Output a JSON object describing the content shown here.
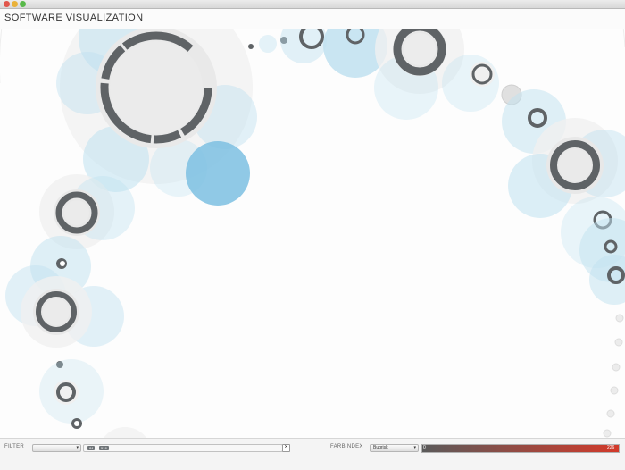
{
  "window": {
    "title": "SOFTWARE VISUALIZATION",
    "traffic_lights": [
      "#e1574c",
      "#e9b23a",
      "#58b94a"
    ]
  },
  "footer": {
    "filter_label": "FILTER",
    "filter_select_value": "",
    "search_tags": [
      "84",
      "518"
    ],
    "clear_symbol": "×",
    "color_index_label": "FARBINDEX",
    "color_index_value": "Bugrisk",
    "scale_min": "0",
    "scale_max": "226"
  },
  "visualization": {
    "colors": {
      "halo": "#bfe1f0",
      "highlight": "#7cc0e2",
      "ring": "#5f6366",
      "inner": "#e9e9e9"
    }
  }
}
